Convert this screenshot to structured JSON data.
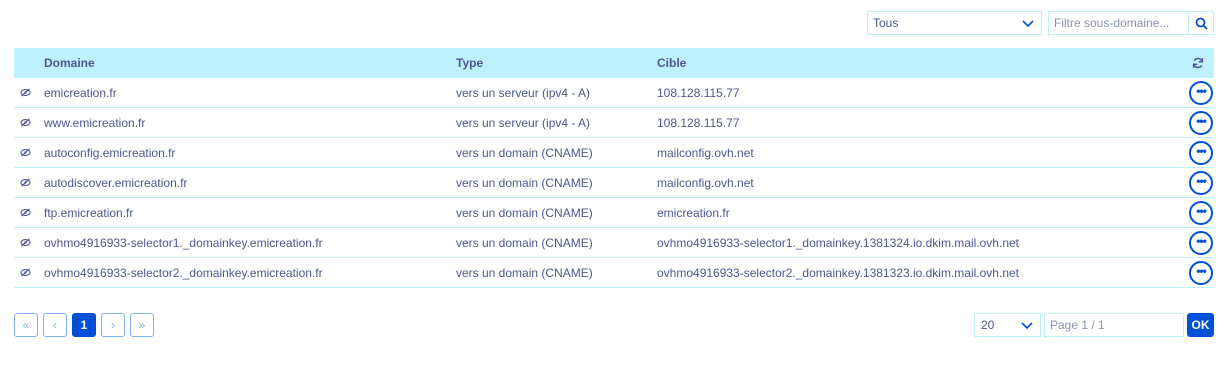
{
  "filter": {
    "type_selected": "Tous",
    "search_placeholder": "Filtre sous-domaine..."
  },
  "table": {
    "headers": {
      "domain": "Domaine",
      "type": "Type",
      "target": "Cible"
    },
    "rows": [
      {
        "domain": "emicreation.fr",
        "type": "vers un serveur (ipv4 - A)",
        "target": "108.128.115.77"
      },
      {
        "domain": "www.emicreation.fr",
        "type": "vers un serveur (ipv4 - A)",
        "target": "108.128.115.77"
      },
      {
        "domain": "autoconfig.emicreation.fr",
        "type": "vers un domain (CNAME)",
        "target": "mailconfig.ovh.net"
      },
      {
        "domain": "autodiscover.emicreation.fr",
        "type": "vers un domain (CNAME)",
        "target": "mailconfig.ovh.net"
      },
      {
        "domain": "ftp.emicreation.fr",
        "type": "vers un domain (CNAME)",
        "target": "emicreation.fr"
      },
      {
        "domain": "ovhmo4916933-selector1._domainkey.emicreation.fr",
        "type": "vers un domain (CNAME)",
        "target": "ovhmo4916933-selector1._domainkey.1381324.io.dkim.mail.ovh.net"
      },
      {
        "domain": "ovhmo4916933-selector2._domainkey.emicreation.fr",
        "type": "vers un domain (CNAME)",
        "target": "ovhmo4916933-selector2._domainkey.1381323.io.dkim.mail.ovh.net"
      }
    ]
  },
  "pagination": {
    "first": "«",
    "prev": "‹",
    "current": "1",
    "next": "›",
    "last": "»",
    "page_size": "20",
    "page_placeholder": "Page 1 / 1",
    "ok_label": "OK"
  },
  "colors": {
    "accent": "#0050d7",
    "header_bg": "#bef1ff",
    "text": "#4d5693"
  },
  "icons": {
    "row_icon": "eye-slash-icon",
    "refresh": "refresh-icon",
    "search": "search-icon",
    "more": "more-options-icon",
    "dropdown": "chevron-down-icon"
  }
}
